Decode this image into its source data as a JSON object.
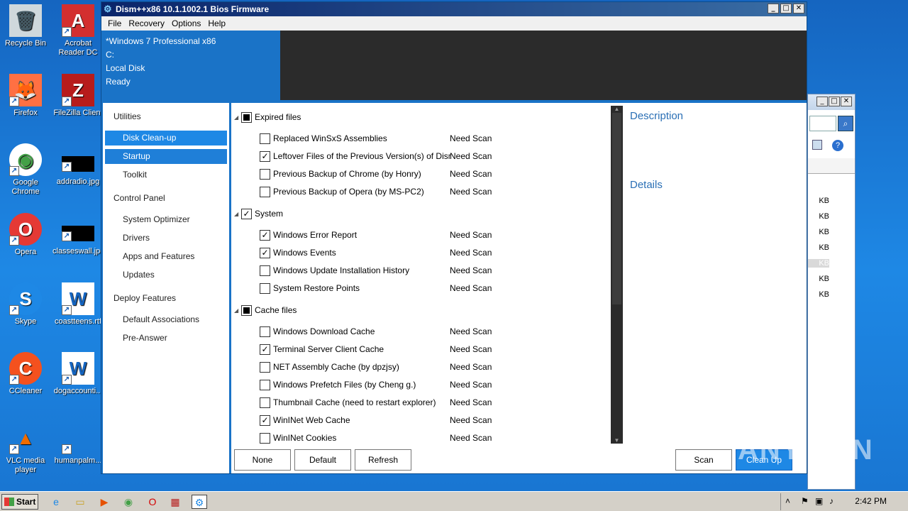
{
  "desktop": {
    "icons": [
      {
        "label": "Recycle Bin",
        "glyph": "🗑"
      },
      {
        "label": "Acrobat Reader DC",
        "glyph": "A"
      },
      {
        "label": "Firefox",
        "glyph": "🦊"
      },
      {
        "label": "FileZilla Client",
        "glyph": "Z"
      },
      {
        "label": "Google Chrome",
        "glyph": "◉"
      },
      {
        "label": "addradio.jpg",
        "glyph": ""
      },
      {
        "label": "Opera",
        "glyph": "O"
      },
      {
        "label": "classeswall.jpg",
        "glyph": ""
      },
      {
        "label": "Skype",
        "glyph": "S"
      },
      {
        "label": "coastteens.rtf",
        "glyph": "W"
      },
      {
        "label": "CCleaner",
        "glyph": "C"
      },
      {
        "label": "dogaccounti...",
        "glyph": "W"
      },
      {
        "label": "VLC media player",
        "glyph": "▲"
      },
      {
        "label": "humanpalm...",
        "glyph": ""
      }
    ]
  },
  "bg_window": {
    "sizes": [
      "KB",
      "KB",
      "KB",
      "KB",
      "KB",
      "KB",
      "KB"
    ]
  },
  "window": {
    "title": "Dism++x86 10.1.1002.1 Bios Firmware",
    "menu": [
      "File",
      "Recovery",
      "Options",
      "Help"
    ],
    "info": {
      "os": "*Windows 7 Professional x86",
      "drive": "C:",
      "disk": "Local Disk",
      "status": "Ready"
    },
    "sidebar": {
      "utilities": "Utilities",
      "disk_cleanup": "Disk Clean-up",
      "startup": "Startup",
      "toolkit": "Toolkit",
      "control_panel": "Control Panel",
      "system_optimizer": "System Optimizer",
      "drivers": "Drivers",
      "apps_features": "Apps and Features",
      "updates": "Updates",
      "deploy_features": "Deploy Features",
      "default_associations": "Default Associations",
      "pre_answer": "Pre-Answer"
    },
    "groups": [
      {
        "label": "Expired files",
        "state": "indeterminate",
        "items": [
          {
            "name": "Replaced WinSxS Assemblies",
            "status": "Need Scan",
            "checked": false
          },
          {
            "name": "Leftover Files of the Previous Version(s) of Dism",
            "status": "Need Scan",
            "checked": true
          },
          {
            "name": "Previous Backup of Chrome (by Honry)",
            "status": "Need Scan",
            "checked": false
          },
          {
            "name": "Previous Backup of Opera (by MS-PC2)",
            "status": "Need Scan",
            "checked": false
          }
        ]
      },
      {
        "label": "System",
        "state": "checked",
        "items": [
          {
            "name": "Windows Error Report",
            "status": "Need Scan",
            "checked": true
          },
          {
            "name": "Windows Events",
            "status": "Need Scan",
            "checked": true
          },
          {
            "name": "Windows Update Installation History",
            "status": "Need Scan",
            "checked": false
          },
          {
            "name": "System Restore Points",
            "status": "Need Scan",
            "checked": false
          }
        ]
      },
      {
        "label": "Cache files",
        "state": "indeterminate",
        "items": [
          {
            "name": "Windows Download Cache",
            "status": "Need Scan",
            "checked": false
          },
          {
            "name": "Terminal Server Client Cache",
            "status": "Need Scan",
            "checked": true
          },
          {
            "name": "NET Assembly Cache (by dpzjsy)",
            "status": "Need Scan",
            "checked": false
          },
          {
            "name": "Windows Prefetch Files (by Cheng g.)",
            "status": "Need Scan",
            "checked": false
          },
          {
            "name": "Thumbnail Cache (need to restart explorer)",
            "status": "Need Scan",
            "checked": false
          },
          {
            "name": "WinINet Web Cache",
            "status": "Need Scan",
            "checked": true
          },
          {
            "name": "WinINet Cookies",
            "status": "Need Scan",
            "checked": false
          }
        ]
      }
    ],
    "description_title": "Description",
    "details_title": "Details",
    "buttons": {
      "none": "None",
      "default": "Default",
      "refresh": "Refresh",
      "scan": "Scan",
      "cleanup": "Clean Up"
    }
  },
  "watermark": "ANY.RUN",
  "taskbar": {
    "start": "Start",
    "clock": "2:42 PM"
  }
}
